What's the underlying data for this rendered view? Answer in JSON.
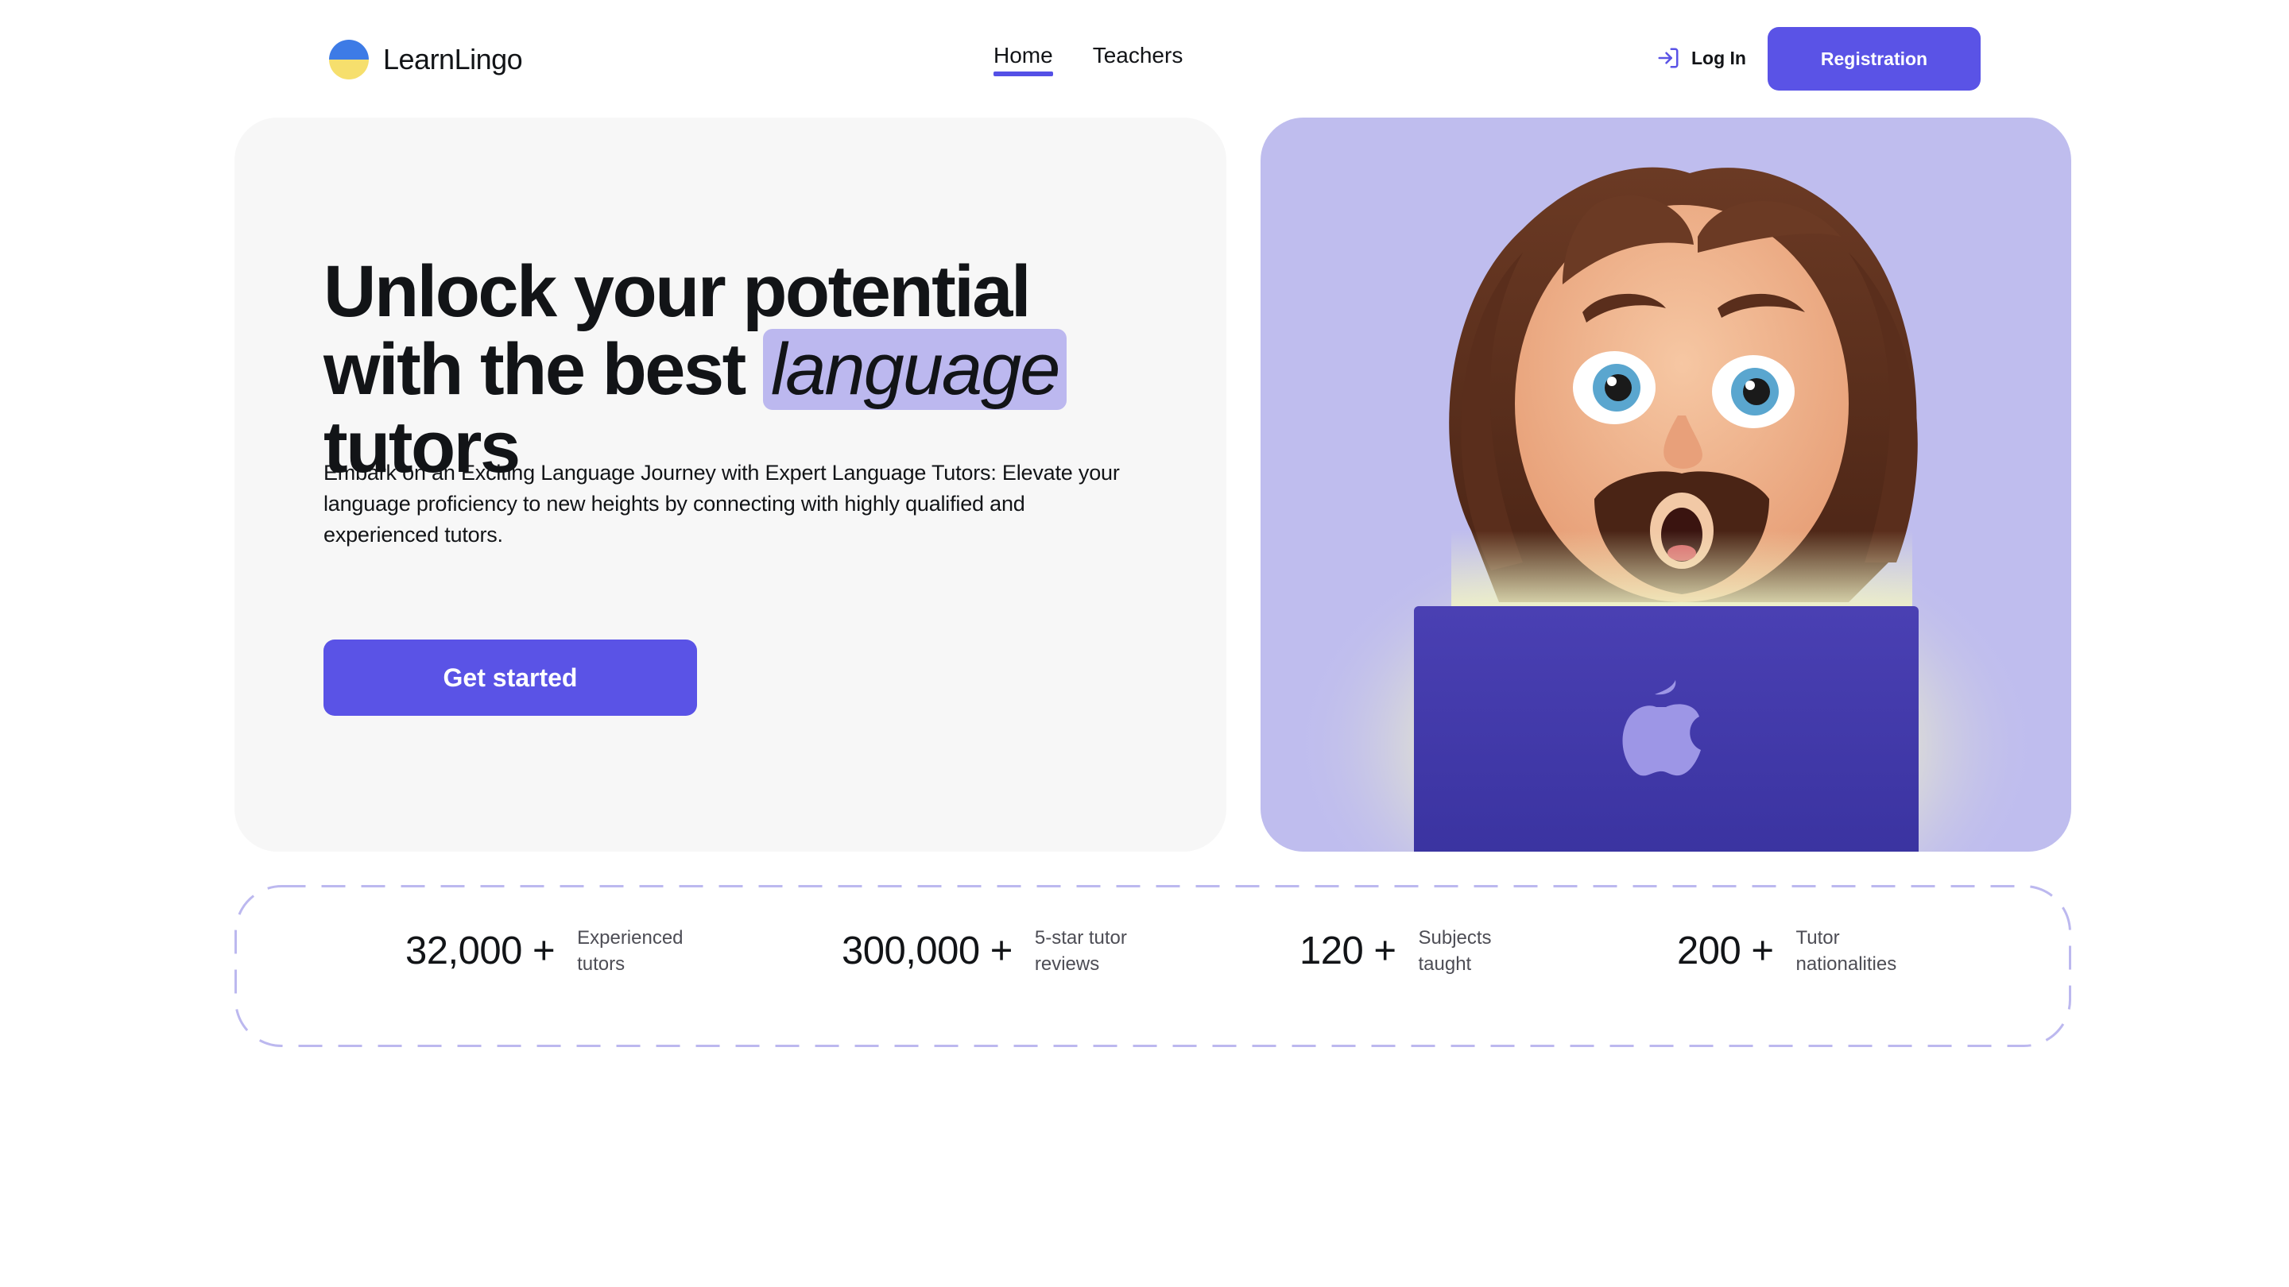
{
  "header": {
    "logo_text": "LearnLingo",
    "nav": [
      {
        "label": "Home",
        "active": true
      },
      {
        "label": "Teachers",
        "active": false
      }
    ],
    "login_label": "Log In",
    "register_label": "Registration"
  },
  "hero": {
    "title_part1": "Unlock your potential with the best",
    "title_highlight": "language",
    "title_part2": "tutors",
    "description": "Embark on an Exciting Language Journey with Expert Language Tutors: Elevate your language proficiency to new heights by connecting with highly qualified and experienced tutors.",
    "cta_label": "Get started"
  },
  "stats": [
    {
      "value": "32,000 +",
      "label": "Experienced tutors"
    },
    {
      "value": "300,000 +",
      "label": "5-star tutor reviews"
    },
    {
      "value": "120 +",
      "label": "Subjects taught"
    },
    {
      "value": "200 +",
      "label": "Tutor nationalities"
    }
  ],
  "colors": {
    "accent": "#5A53E6",
    "highlight": "#BCB8EF",
    "hero_left_bg": "#F7F7F7",
    "hero_right_bg": "#BFBDEE",
    "stats_border": "#BCB8EF"
  },
  "icons": {
    "logo": "ukraine-flag-circle-icon",
    "login": "login-arrow-icon",
    "laptop_logo": "apple-logo-icon"
  }
}
